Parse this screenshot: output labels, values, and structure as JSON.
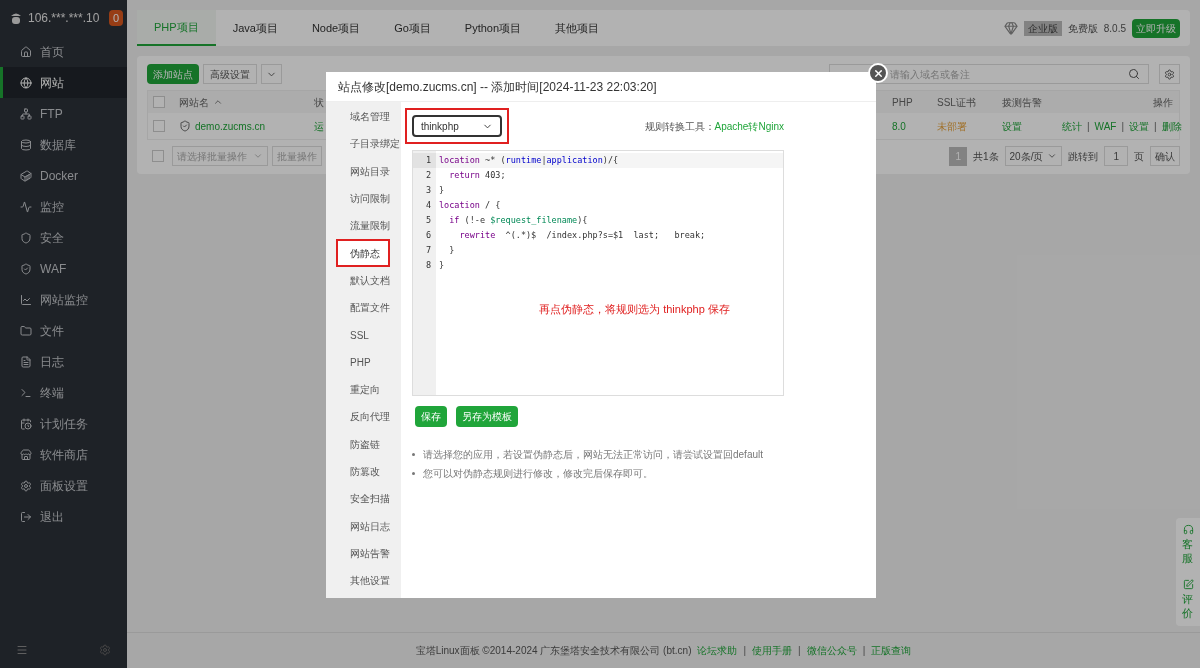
{
  "server": {
    "address": "106.***.***.10",
    "alerts": "0"
  },
  "sidebar": {
    "items": [
      {
        "label": "首页",
        "selected": false
      },
      {
        "label": "网站",
        "selected": true
      },
      {
        "label": "FTP",
        "selected": false
      },
      {
        "label": "数据库",
        "selected": false
      },
      {
        "label": "Docker",
        "selected": false
      },
      {
        "label": "监控",
        "selected": false
      },
      {
        "label": "安全",
        "selected": false
      },
      {
        "label": "WAF",
        "selected": false
      },
      {
        "label": "网站监控",
        "selected": false
      },
      {
        "label": "文件",
        "selected": false
      },
      {
        "label": "日志",
        "selected": false
      },
      {
        "label": "终端",
        "selected": false
      },
      {
        "label": "计划任务",
        "selected": false
      },
      {
        "label": "软件商店",
        "selected": false
      },
      {
        "label": "面板设置",
        "selected": false
      },
      {
        "label": "退出",
        "selected": false
      }
    ]
  },
  "tabs": [
    {
      "label": "PHP项目",
      "selected": true
    },
    {
      "label": "Java项目",
      "selected": false
    },
    {
      "label": "Node项目",
      "selected": false
    },
    {
      "label": "Go项目",
      "selected": false
    },
    {
      "label": "Python项目",
      "selected": false
    },
    {
      "label": "其他项目",
      "selected": false
    }
  ],
  "edition": {
    "enterprise": "企业版",
    "free": "免费版",
    "version": "8.0.5",
    "upgrade": "立即升级"
  },
  "toolbar": {
    "add_site": "添加站点",
    "advanced": "高级设置",
    "search_placeholder": "请输入域名或备注"
  },
  "table": {
    "select_all_checked": false,
    "columns": [
      "网站名",
      "状",
      "PHP",
      "SSL证书",
      "拨测告警",
      "操作"
    ],
    "rows": [
      {
        "checked": false,
        "name": "demo.zucms.cn",
        "status": "运",
        "php": "8.0",
        "ssl": "未部署",
        "alert": "设置",
        "actions": [
          {
            "kind": "link",
            "text": "统计"
          },
          {
            "kind": "separator",
            "text": "|"
          },
          {
            "kind": "link",
            "text": "WAF"
          },
          {
            "kind": "separator",
            "text": "|"
          },
          {
            "kind": "link",
            "text": "设置"
          },
          {
            "kind": "separator",
            "text": "|"
          },
          {
            "kind": "link",
            "text": "删除"
          }
        ]
      }
    ]
  },
  "batch": {
    "checked": false,
    "placeholder": "请选择批量操作",
    "button": "批量操作"
  },
  "pagination": {
    "page": "1",
    "total": "共1条",
    "per_page": "20条/页",
    "jump": "跳转到",
    "jump_value": "1",
    "unit": "页",
    "confirm": "确认"
  },
  "dialog": {
    "title": "站点修改[demo.zucms.cn] -- 添加时间[2024-11-23 22:03:20]",
    "menu": [
      {
        "label": "域名管理",
        "selected": false
      },
      {
        "label": "子目录绑定",
        "selected": false
      },
      {
        "label": "网站目录",
        "selected": false
      },
      {
        "label": "访问限制",
        "selected": false
      },
      {
        "label": "流量限制",
        "selected": false
      },
      {
        "label": "伪静态",
        "selected": true
      },
      {
        "label": "默认文档",
        "selected": false
      },
      {
        "label": "配置文件",
        "selected": false
      },
      {
        "label": "SSL",
        "selected": false
      },
      {
        "label": "PHP",
        "selected": false
      },
      {
        "label": "重定向",
        "selected": false
      },
      {
        "label": "反向代理",
        "selected": false
      },
      {
        "label": "防盗链",
        "selected": false
      },
      {
        "label": "防篡改",
        "selected": false
      },
      {
        "label": "安全扫描",
        "selected": false
      },
      {
        "label": "网站日志",
        "selected": false
      },
      {
        "label": "网站告警",
        "selected": false
      },
      {
        "label": "其他设置",
        "selected": false
      }
    ],
    "rule_select": "thinkphp",
    "converter_label": "规则转换工具：",
    "converter_link": "Apache转Nginx",
    "code": [
      {
        "number": "1",
        "segments": [
          {
            "text": "location",
            "kind": "keyword"
          },
          {
            "text": " ~* (",
            "kind": "plain"
          },
          {
            "text": "runtime",
            "kind": "name"
          },
          {
            "text": "|",
            "kind": "plain"
          },
          {
            "text": "application",
            "kind": "name"
          },
          {
            "text": ")/{",
            "kind": "plain"
          }
        ]
      },
      {
        "number": "2",
        "segments": [
          {
            "text": "  return",
            "kind": "keyword"
          },
          {
            "text": " 403;",
            "kind": "plain"
          }
        ]
      },
      {
        "number": "3",
        "segments": [
          {
            "text": "}",
            "kind": "plain"
          }
        ]
      },
      {
        "number": "4",
        "segments": [
          {
            "text": "location",
            "kind": "keyword"
          },
          {
            "text": " / {",
            "kind": "plain"
          }
        ]
      },
      {
        "number": "5",
        "segments": [
          {
            "text": "  if",
            "kind": "keyword"
          },
          {
            "text": " (!-e ",
            "kind": "plain"
          },
          {
            "text": "$request_filename",
            "kind": "variable"
          },
          {
            "text": "){",
            "kind": "plain"
          }
        ]
      },
      {
        "number": "6",
        "segments": [
          {
            "text": "    rewrite",
            "kind": "keyword"
          },
          {
            "text": "  ^(.*)$  /index.php?s=$1  last;   break;",
            "kind": "plain"
          }
        ]
      },
      {
        "number": "7",
        "segments": [
          {
            "text": "  }",
            "kind": "plain"
          }
        ]
      },
      {
        "number": "8",
        "segments": [
          {
            "text": "}",
            "kind": "plain"
          }
        ]
      }
    ],
    "annotation": "再点伪静态，将规则选为 thinkphp 保存",
    "buttons": [
      "保存",
      "另存为模板"
    ],
    "notes": [
      "请选择您的应用，若设置伪静态后，网站无法正常访问，请尝试设置回default",
      "您可以对伪静态规则进行修改，修改完后保存即可。"
    ]
  },
  "float_widget": [
    "客服",
    "评价"
  ],
  "footer": {
    "copyright": "宝塔Linux面板 ©2014-2024 广东堡塔安全技术有限公司 (bt.cn)",
    "links": [
      {
        "kind": "link",
        "text": "论坛求助"
      },
      {
        "kind": "separator",
        "text": "|"
      },
      {
        "kind": "link",
        "text": "使用手册"
      },
      {
        "kind": "separator",
        "text": "|"
      },
      {
        "kind": "link",
        "text": "微信公众号"
      },
      {
        "kind": "separator",
        "text": "|"
      },
      {
        "kind": "link",
        "text": "正版查询"
      }
    ]
  }
}
